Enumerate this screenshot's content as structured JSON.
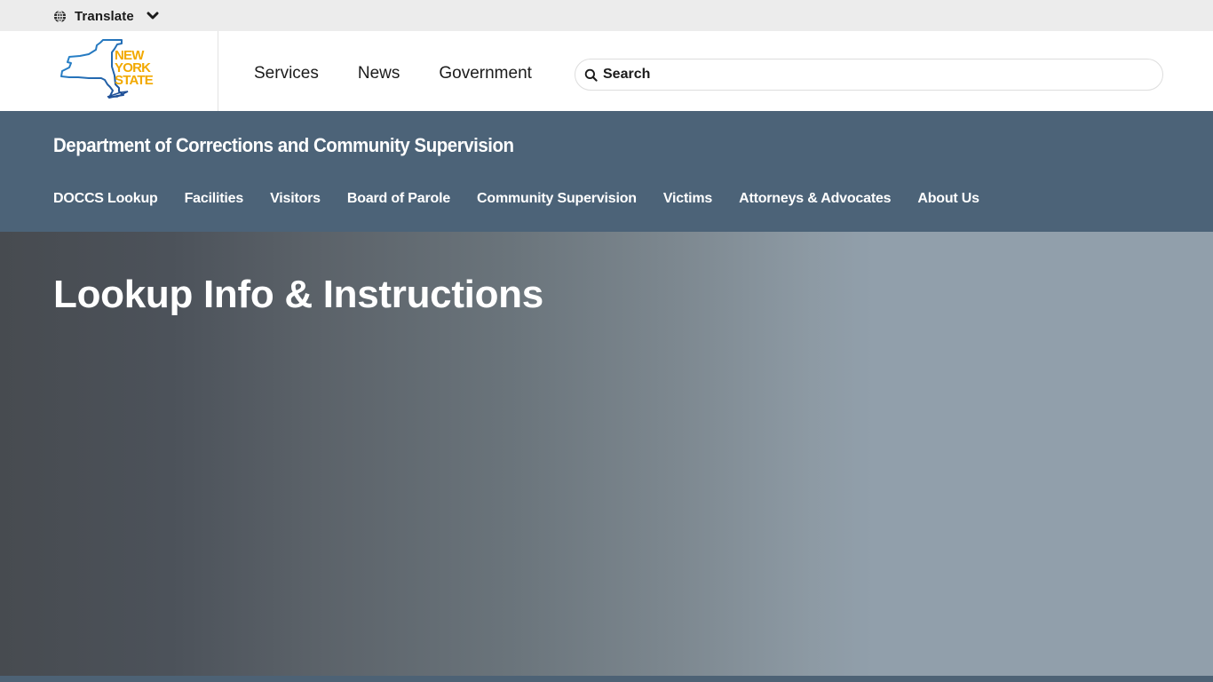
{
  "topbar": {
    "translate_label": "Translate",
    "icons": {
      "globe": "globe-icon",
      "chevron": "chevron-down-icon"
    }
  },
  "header": {
    "logo": {
      "lines": [
        "NEW",
        "YORK",
        "STATE"
      ],
      "outline_color": "#1f5aa6",
      "text_color": "#f2a900"
    },
    "nav": [
      {
        "label": "Services"
      },
      {
        "label": "News"
      },
      {
        "label": "Government"
      }
    ],
    "search": {
      "placeholder": "Search",
      "value": "",
      "icon": "search-icon"
    }
  },
  "agency": {
    "title": "Department of Corrections and Community Supervision",
    "background_color": "#4c6378",
    "nav": [
      {
        "label": "DOCCS Lookup"
      },
      {
        "label": "Facilities"
      },
      {
        "label": "Visitors"
      },
      {
        "label": "Board of Parole"
      },
      {
        "label": "Community Supervision"
      },
      {
        "label": "Victims"
      },
      {
        "label": "Attorneys & Advocates"
      },
      {
        "label": "About Us"
      }
    ]
  },
  "hero": {
    "title": "Lookup Info & Instructions",
    "gradient": {
      "start": "#474b50",
      "end": "#919fab"
    }
  }
}
